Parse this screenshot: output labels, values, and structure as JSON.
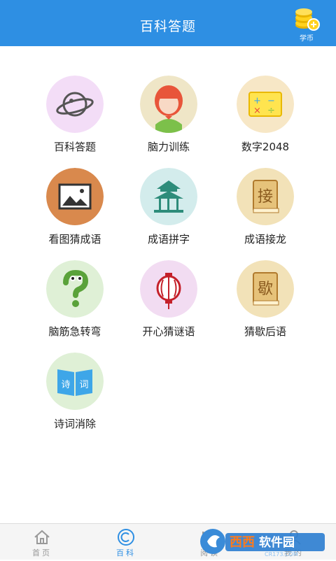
{
  "header": {
    "title": "百科答题",
    "coin_label": "学币"
  },
  "items": [
    {
      "label": "百科答题",
      "icon": "planet-icon"
    },
    {
      "label": "脑力训练",
      "icon": "girl-avatar-icon"
    },
    {
      "label": "数字2048",
      "icon": "math-board-icon"
    },
    {
      "label": "看图猜成语",
      "icon": "picture-icon"
    },
    {
      "label": "成语拼字",
      "icon": "pavilion-icon"
    },
    {
      "label": "成语接龙",
      "icon": "book-jie-icon"
    },
    {
      "label": "脑筋急转弯",
      "icon": "question-mark-icon"
    },
    {
      "label": "开心猜谜语",
      "icon": "lantern-icon"
    },
    {
      "label": "猜歇后语",
      "icon": "book-xie-icon"
    },
    {
      "label": "诗词消除",
      "icon": "poetry-book-icon"
    }
  ],
  "tabs": [
    {
      "label": "首页",
      "icon": "home-icon",
      "active": false
    },
    {
      "label": "百科",
      "icon": "encyclopedia-icon",
      "active": true
    },
    {
      "label": "阅读",
      "icon": "read-icon",
      "active": false
    },
    {
      "label": "我的",
      "icon": "profile-icon",
      "active": false
    }
  ],
  "watermark": {
    "text": "西西软件园",
    "subtext": "CR173.COM"
  },
  "colors": {
    "header": "#2e8fe3",
    "accent": "#2e8fe3",
    "label": "#222222",
    "tab_inactive": "#999999"
  }
}
